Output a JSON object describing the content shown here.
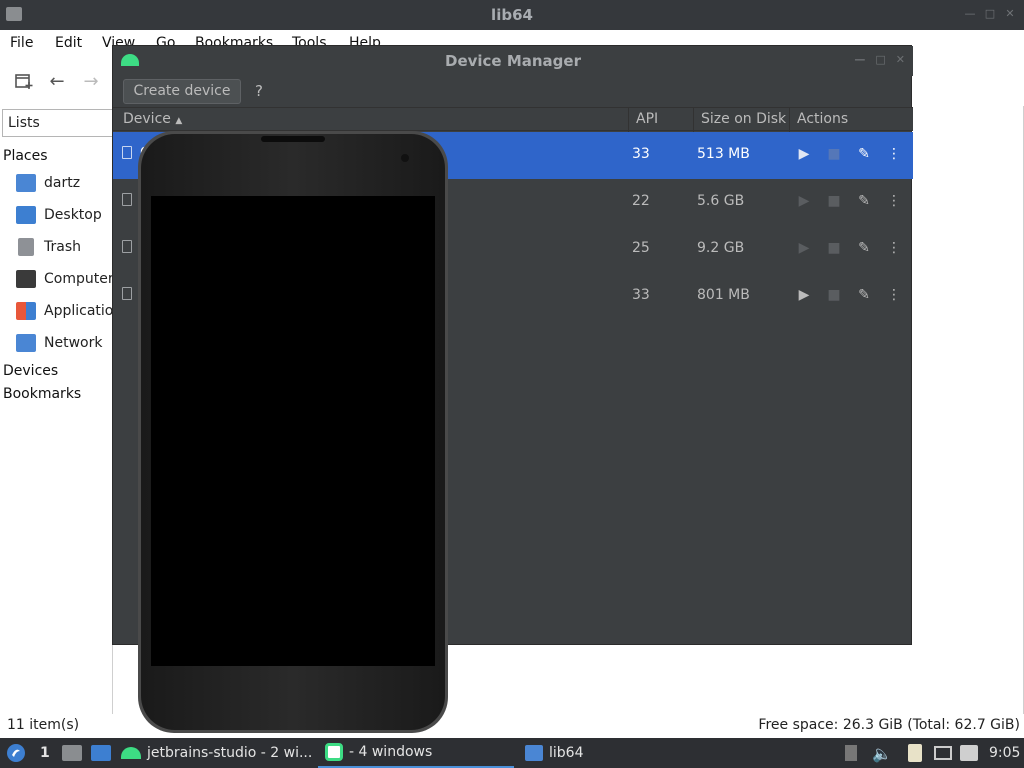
{
  "file_manager": {
    "title": "lib64",
    "menu": [
      "File",
      "Edit",
      "View",
      "Go",
      "Bookmarks",
      "Tools",
      "Help"
    ],
    "sidebar": {
      "view_select": "Lists",
      "places_header": "Places",
      "places": [
        {
          "label": "dartz",
          "icon": "home-folder-icon",
          "color": "#4a86d4"
        },
        {
          "label": "Desktop",
          "icon": "desktop-icon",
          "color": "#3d7fd1"
        },
        {
          "label": "Trash",
          "icon": "trash-icon",
          "color": "#8e9196"
        },
        {
          "label": "Computer",
          "icon": "computer-icon",
          "color": "#3a3a3a"
        },
        {
          "label": "Applications",
          "icon": "applications-icon",
          "color": "#e8573a"
        },
        {
          "label": "Network",
          "icon": "network-icon",
          "color": "#4a86d4"
        }
      ],
      "devices_header": "Devices",
      "bookmarks_header": "Bookmarks"
    },
    "status": {
      "items": "11 item(s)",
      "free_space": "Free space: 26.3 GiB (Total: 62.7 GiB)"
    }
  },
  "device_manager": {
    "title": "Device Manager",
    "create_label": "Create device",
    "help_label": "?",
    "columns": [
      "Device",
      "API",
      "Size on Disk",
      "Actions"
    ],
    "rows": [
      {
        "name": "G",
        "api": "33",
        "size": "513 MB",
        "selected": true,
        "run_enabled": true,
        "folder_enabled": false
      },
      {
        "name": "",
        "api": "22",
        "size": "5.6 GB",
        "selected": false,
        "run_enabled": false,
        "folder_enabled": false
      },
      {
        "name": "",
        "api": "25",
        "size": "9.2 GB",
        "selected": false,
        "run_enabled": false,
        "folder_enabled": false
      },
      {
        "name": "",
        "api": "33",
        "size": "801 MB",
        "selected": false,
        "run_enabled": true,
        "folder_enabled": false
      }
    ]
  },
  "taskbar": {
    "workspace": "1",
    "tasks": [
      {
        "label": "jetbrains-studio - 2 wi...",
        "icon": "android-icon"
      },
      {
        "label": "- 4 windows",
        "icon": "emulator-icon",
        "active": true
      },
      {
        "label": "lib64",
        "icon": "folder-icon"
      }
    ],
    "clock": "9:05"
  },
  "colors": {
    "selection": "#2f65ca",
    "dark_panel": "#3c3f41",
    "taskbar": "#2d2f33",
    "android_green": "#3ddc84"
  }
}
